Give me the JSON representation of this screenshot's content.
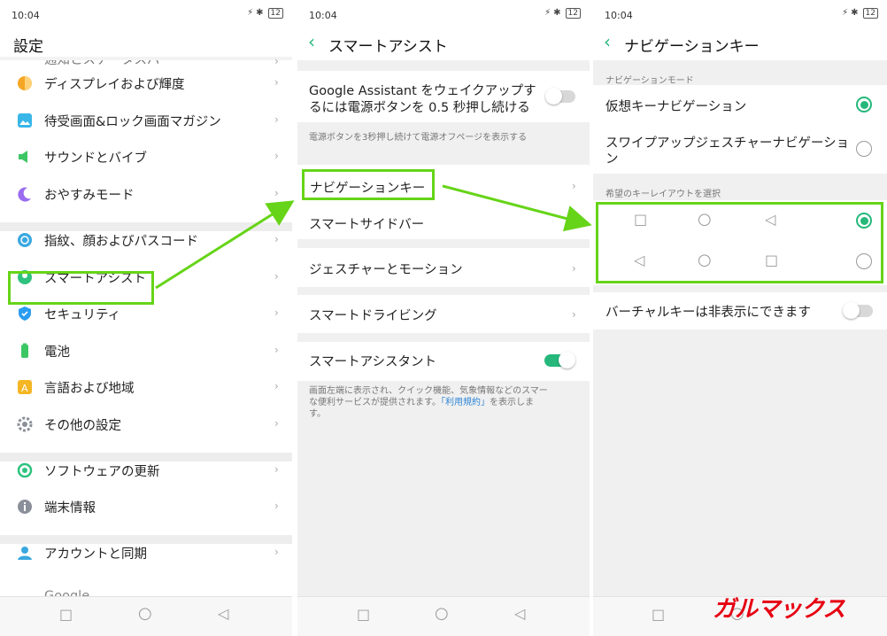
{
  "status": {
    "time": "10:04",
    "battery": "12"
  },
  "panel1": {
    "title": "設定",
    "partial_item": "通知とステータスバー",
    "items": [
      {
        "label": "ディスプレイおよび輝度",
        "icon": "brightness-icon",
        "color": "#f5a623"
      },
      {
        "label": "待受画面&ロック画面マガジン",
        "icon": "wallpaper-icon",
        "color": "#38b6e8"
      },
      {
        "label": "サウンドとバイブ",
        "icon": "speaker-icon",
        "color": "#3cc764"
      },
      {
        "label": "おやすみモード",
        "icon": "moon-icon",
        "color": "#9b6cf0"
      },
      {
        "label": "指紋、顔およびパスコード",
        "icon": "fingerprint-face-icon",
        "color": "#3aa8e0"
      },
      {
        "label": "スマートアシスト",
        "icon": "smart-assist-icon",
        "color": "#2ec27e"
      },
      {
        "label": "セキュリティ",
        "icon": "shield-icon",
        "color": "#2a9df0"
      },
      {
        "label": "電池",
        "icon": "battery-icon",
        "color": "#3cc764"
      },
      {
        "label": "言語および地域",
        "icon": "language-icon",
        "color": "#f5b623"
      },
      {
        "label": "その他の設定",
        "icon": "gear-icon",
        "color": "#8a8f99"
      },
      {
        "label": "ソフトウェアの更新",
        "icon": "update-icon",
        "color": "#2ec27e"
      },
      {
        "label": "端末情報",
        "icon": "info-icon",
        "color": "#8a8f99"
      },
      {
        "label": "アカウントと同期",
        "icon": "account-icon",
        "color": "#3aa8e0"
      }
    ],
    "partial_bottom": "Google"
  },
  "panel2": {
    "title": "スマートアシスト",
    "google_assistant_line1": "Google Assistant をウェイクアップす",
    "google_assistant_line2": "るには電源ボタンを 0.5 秒押し続ける",
    "google_assistant_note": "電源ボタンを3秒押し続けて電源オフページを表示する",
    "nav_key": "ナビゲーションキー",
    "smart_sidebar": "スマートサイドバー",
    "gesture_motion": "ジェスチャーとモーション",
    "smart_driving": "スマートドライビング",
    "smart_assistant": "スマートアシスタント",
    "smart_assistant_desc_line1": "画面左端に表示され、クイック機能、気象情報などのスマー",
    "smart_assistant_desc_line2a": "な便利サービスが提供されます。",
    "smart_assistant_desc_link": "「利用規約」",
    "smart_assistant_desc_line2b": "を表示しま",
    "smart_assistant_desc_line3": "す。",
    "google_assistant_enabled": false,
    "smart_assistant_enabled": true
  },
  "panel3": {
    "title": "ナビゲーションキー",
    "nav_mode_header": "ナビゲーションモード",
    "virtual_key_nav": "仮想キーナビゲーション",
    "swipe_nav_line1": "スワイプアップジェスチャーナビゲーショ",
    "swipe_nav_line2": "ン",
    "layout_header": "希望のキーレイアウトを選択",
    "layout1_keys": [
      "□",
      "○",
      "◁"
    ],
    "layout2_keys": [
      "◁",
      "○",
      "□"
    ],
    "hide_virtual_keys": "バーチャルキーは非表示にできます",
    "selected_mode": "virtual",
    "selected_layout": 1,
    "hide_keys_enabled": false
  },
  "navbar_keys": [
    "□",
    "○",
    "◁"
  ],
  "watermark": "ガルマックス",
  "colors": {
    "accent": "#25b87a",
    "highlight": "#66d418",
    "link": "#2f86d6",
    "watermark": "#e60012"
  }
}
